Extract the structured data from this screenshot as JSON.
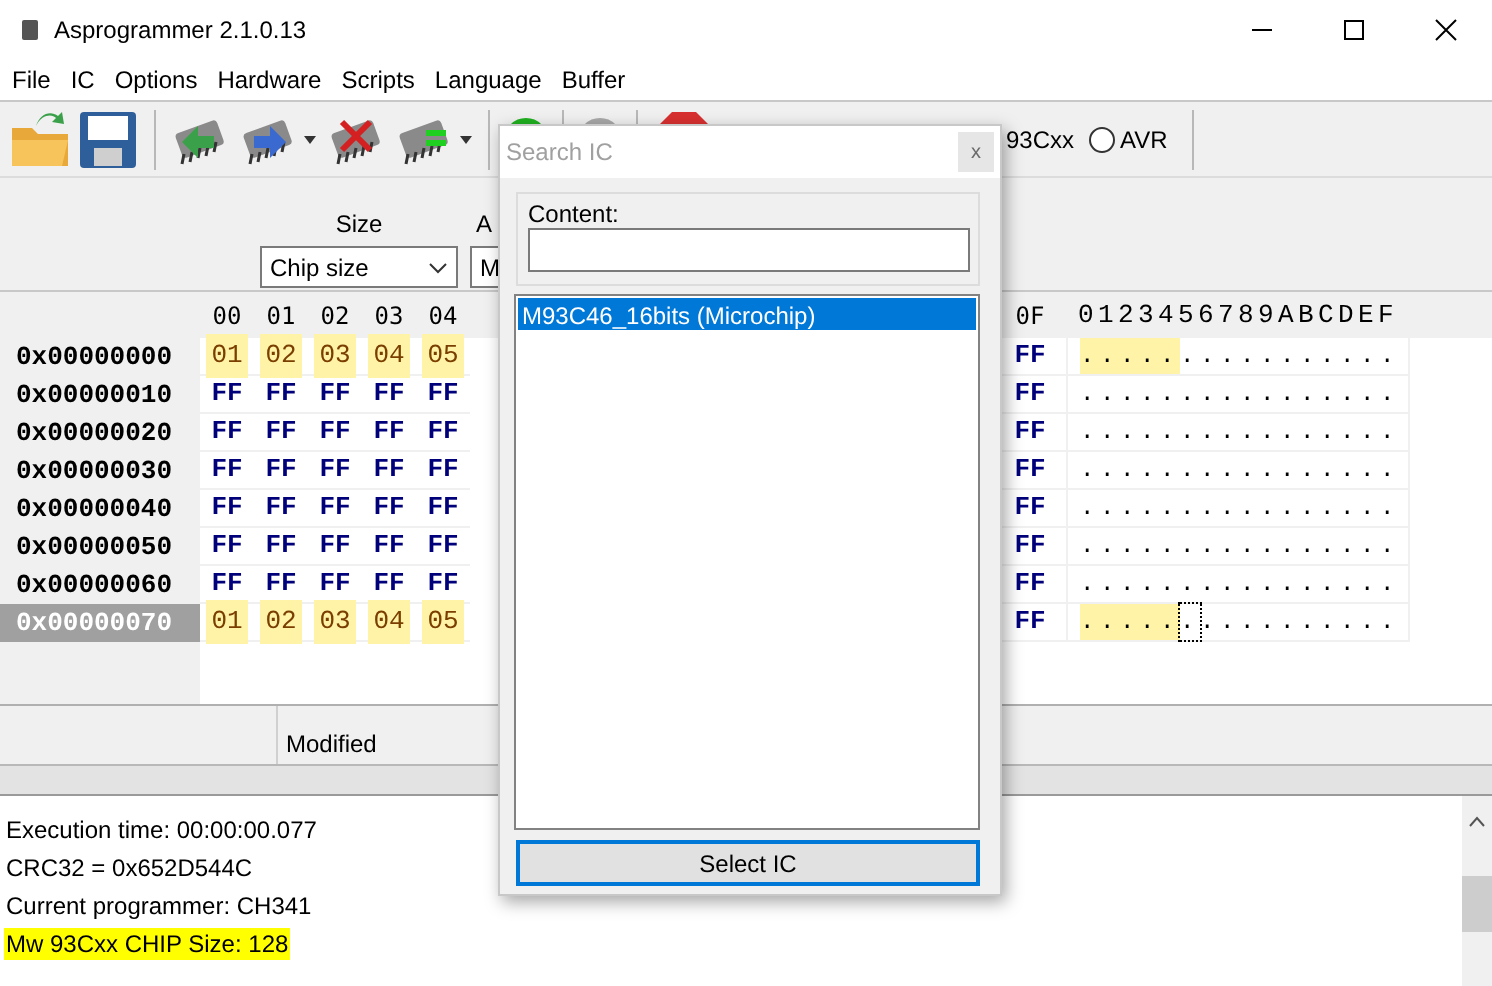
{
  "window": {
    "title": "Asprogrammer 2.1.0.13"
  },
  "menu": [
    "File",
    "IC",
    "Options",
    "Hardware",
    "Scripts",
    "Language",
    "Buffer"
  ],
  "toolbar": {
    "buttons": [
      {
        "kind": "open"
      },
      {
        "kind": "save"
      },
      {
        "kind": "sep"
      },
      {
        "kind": "read"
      },
      {
        "kind": "write",
        "dropdown": true
      },
      {
        "kind": "erase"
      },
      {
        "kind": "verify",
        "dropdown": true
      },
      {
        "kind": "sep"
      },
      {
        "kind": "detect"
      },
      {
        "kind": "sep"
      },
      {
        "kind": "gray"
      },
      {
        "kind": "sep"
      },
      {
        "kind": "stop"
      }
    ],
    "partial_label": "93Cxx",
    "radios": [
      {
        "label": "AVR",
        "selected": false
      }
    ]
  },
  "options": {
    "size_label": "Size",
    "size_value": "Chip size",
    "second_label": "A",
    "second_value": "M"
  },
  "hex": {
    "columns": [
      "00",
      "01",
      "02",
      "03",
      "04"
    ],
    "right_columns": [
      "0F"
    ],
    "ascii_header": "0123456789ABCDEF",
    "rows": [
      {
        "address": "0x00000000",
        "selected": false,
        "cells": [
          {
            "text": "01",
            "modified": true
          },
          {
            "text": "02",
            "modified": true
          },
          {
            "text": "03",
            "modified": true
          },
          {
            "text": "04",
            "modified": true
          },
          {
            "text": "05",
            "modified": true
          }
        ],
        "right_cells": [
          {
            "text": "FF",
            "modified": false
          }
        ],
        "ascii": [
          {
            "text": ".....",
            "highlighted": true,
            "focused": false
          },
          {
            "text": "...........",
            "highlighted": false,
            "focused": false
          }
        ]
      },
      {
        "address": "0x00000010",
        "selected": false,
        "cells": [
          {
            "text": "FF",
            "modified": false
          },
          {
            "text": "FF",
            "modified": false
          },
          {
            "text": "FF",
            "modified": false
          },
          {
            "text": "FF",
            "modified": false
          },
          {
            "text": "FF",
            "modified": false
          }
        ],
        "right_cells": [
          {
            "text": "FF",
            "modified": false
          }
        ],
        "ascii": [
          {
            "text": "................",
            "highlighted": false,
            "focused": false
          }
        ]
      },
      {
        "address": "0x00000020",
        "selected": false,
        "cells": [
          {
            "text": "FF",
            "modified": false
          },
          {
            "text": "FF",
            "modified": false
          },
          {
            "text": "FF",
            "modified": false
          },
          {
            "text": "FF",
            "modified": false
          },
          {
            "text": "FF",
            "modified": false
          }
        ],
        "right_cells": [
          {
            "text": "FF",
            "modified": false
          }
        ],
        "ascii": [
          {
            "text": "................",
            "highlighted": false,
            "focused": false
          }
        ]
      },
      {
        "address": "0x00000030",
        "selected": false,
        "cells": [
          {
            "text": "FF",
            "modified": false
          },
          {
            "text": "FF",
            "modified": false
          },
          {
            "text": "FF",
            "modified": false
          },
          {
            "text": "FF",
            "modified": false
          },
          {
            "text": "FF",
            "modified": false
          }
        ],
        "right_cells": [
          {
            "text": "FF",
            "modified": false
          }
        ],
        "ascii": [
          {
            "text": "................",
            "highlighted": false,
            "focused": false
          }
        ]
      },
      {
        "address": "0x00000040",
        "selected": false,
        "cells": [
          {
            "text": "FF",
            "modified": false
          },
          {
            "text": "FF",
            "modified": false
          },
          {
            "text": "FF",
            "modified": false
          },
          {
            "text": "FF",
            "modified": false
          },
          {
            "text": "FF",
            "modified": false
          }
        ],
        "right_cells": [
          {
            "text": "FF",
            "modified": false
          }
        ],
        "ascii": [
          {
            "text": "................",
            "highlighted": false,
            "focused": false
          }
        ]
      },
      {
        "address": "0x00000050",
        "selected": false,
        "cells": [
          {
            "text": "FF",
            "modified": false
          },
          {
            "text": "FF",
            "modified": false
          },
          {
            "text": "FF",
            "modified": false
          },
          {
            "text": "FF",
            "modified": false
          },
          {
            "text": "FF",
            "modified": false
          }
        ],
        "right_cells": [
          {
            "text": "FF",
            "modified": false
          }
        ],
        "ascii": [
          {
            "text": "................",
            "highlighted": false,
            "focused": false
          }
        ]
      },
      {
        "address": "0x00000060",
        "selected": false,
        "cells": [
          {
            "text": "FF",
            "modified": false
          },
          {
            "text": "FF",
            "modified": false
          },
          {
            "text": "FF",
            "modified": false
          },
          {
            "text": "FF",
            "modified": false
          },
          {
            "text": "FF",
            "modified": false
          }
        ],
        "right_cells": [
          {
            "text": "FF",
            "modified": false
          }
        ],
        "ascii": [
          {
            "text": "................",
            "highlighted": false,
            "focused": false
          }
        ]
      },
      {
        "address": "0x00000070",
        "selected": true,
        "cells": [
          {
            "text": "01",
            "modified": true
          },
          {
            "text": "02",
            "modified": true
          },
          {
            "text": "03",
            "modified": true
          },
          {
            "text": "04",
            "modified": true
          },
          {
            "text": "05",
            "modified": true
          }
        ],
        "right_cells": [
          {
            "text": "FF",
            "modified": false
          }
        ],
        "ascii": [
          {
            "text": ".....",
            "highlighted": true,
            "focused": false
          },
          {
            "text": ".",
            "highlighted": false,
            "focused": true
          },
          {
            "text": "..........",
            "highlighted": false,
            "focused": false
          }
        ]
      }
    ]
  },
  "status_bar": {
    "text": "Modified"
  },
  "log": [
    {
      "text": "Execution time: 00:00:00.077",
      "highlighted": false
    },
    {
      "text": "CRC32 = 0x652D544C",
      "highlighted": false
    },
    {
      "text": "Current programmer: CH341",
      "highlighted": false
    },
    {
      "text": "Mw 93Cxx CHIP Size: 128",
      "highlighted": true
    }
  ],
  "dialog": {
    "title": "Search IC",
    "close": "x",
    "content_label": "Content:",
    "items": [
      {
        "label": "M93C46_16bits (Microchip)",
        "selected": true
      }
    ],
    "button": "Select IC"
  }
}
